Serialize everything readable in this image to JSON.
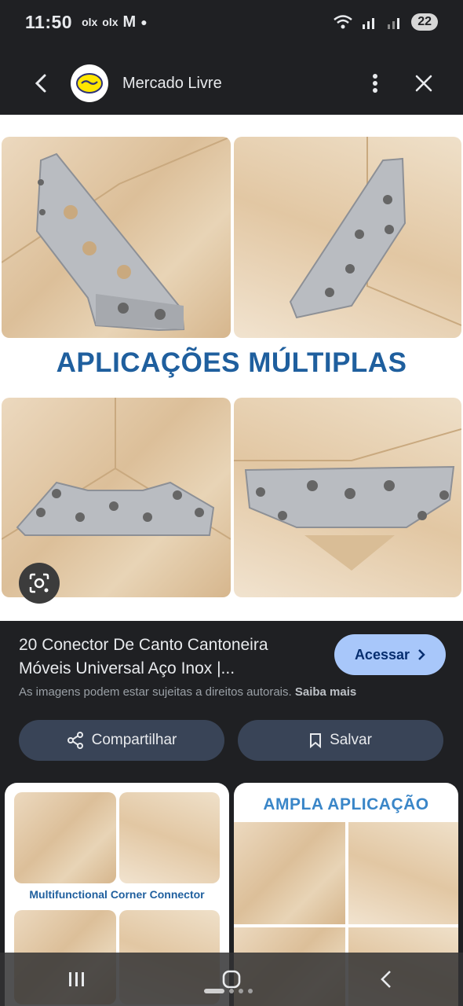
{
  "status_bar": {
    "time": "11:50",
    "notif_1": "olx",
    "notif_2": "olx",
    "notif_3": "M",
    "battery": "22"
  },
  "header": {
    "title": "Mercado Livre",
    "icons": [
      "back-arrow-icon",
      "mercado-livre-logo",
      "more-vert-icon",
      "close-icon"
    ]
  },
  "main_image": {
    "banner_text": "APLICAÇÕES MÚLTIPLAS"
  },
  "product": {
    "title": "20 Conector De Canto Cantoneira Móveis Universal Aço Inox |...",
    "access_label": "Acessar",
    "copyright_text": "As imagens podem estar sujeitas a direitos autorais.",
    "copyright_link": "Saiba mais",
    "share_label": "Compartilhar",
    "save_label": "Salvar"
  },
  "related": [
    {
      "caption": "Multifunctional Corner Connector"
    },
    {
      "caption": "AMPLA APLICAÇÃO"
    }
  ],
  "colors": {
    "background": "#1f2023",
    "accent_button": "#a8c7fa",
    "action_button": "#394457",
    "banner_blue": "#1f5f9e"
  }
}
